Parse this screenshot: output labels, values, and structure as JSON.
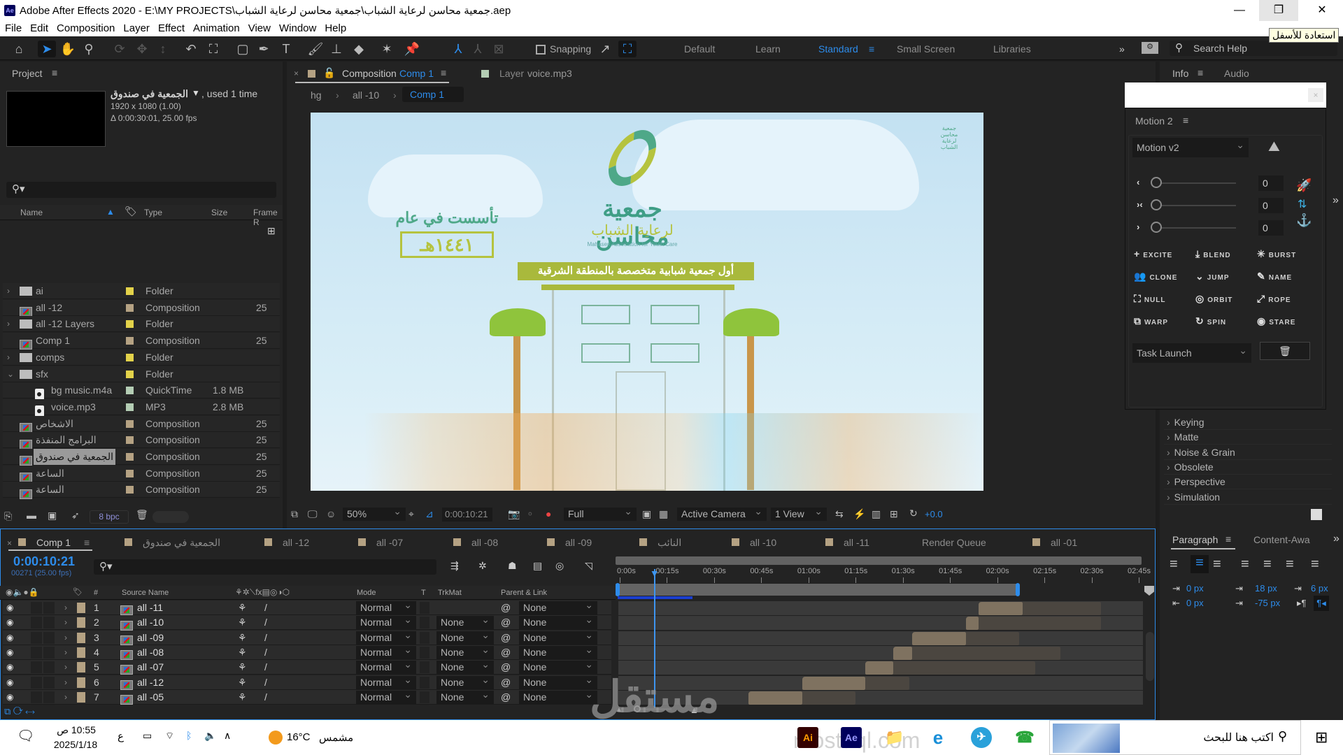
{
  "window": {
    "app_icon": "Ae",
    "title": "Adobe After Effects 2020 - E:\\MY PROJECTS\\جمعية محاسن لرعاية الشباب\\جمعية محاسن لرعاية الشباب.aep",
    "minimize": "—",
    "restore": "❐",
    "close": "✕",
    "tooltip": "استعادة للأسفل"
  },
  "menu": [
    "File",
    "Edit",
    "Composition",
    "Layer",
    "Effect",
    "Animation",
    "View",
    "Window",
    "Help"
  ],
  "toolbar": {
    "snapping_label": "Snapping",
    "workspaces": [
      "Default",
      "Learn",
      "Standard",
      "Small Screen",
      "Libraries"
    ],
    "active_workspace": "Standard",
    "search_placeholder": "Search Help"
  },
  "project": {
    "panel_title": "Project",
    "selected_name": "الجمعية في صندوق",
    "used": ", used 1 time",
    "resolution": "1920 x 1080 (1.00)",
    "duration": "Δ 0:00:30:01, 25.00 fps",
    "columns": {
      "name": "Name",
      "type": "Type",
      "size": "Size",
      "frame_rate": "Frame R"
    },
    "items": [
      {
        "name": "ai",
        "kind": "folder",
        "expand": "›",
        "color": "#e3d24a",
        "type": "Folder",
        "size": "",
        "fps": ""
      },
      {
        "name": "all -12",
        "kind": "comp",
        "expand": "",
        "color": "#b5a283",
        "type": "Composition",
        "size": "",
        "fps": "25"
      },
      {
        "name": "all -12 Layers",
        "kind": "folder",
        "expand": "›",
        "color": "#e3d24a",
        "type": "Folder",
        "size": "",
        "fps": ""
      },
      {
        "name": "Comp 1",
        "kind": "comp",
        "expand": "",
        "color": "#b5a283",
        "type": "Composition",
        "size": "",
        "fps": "25"
      },
      {
        "name": "comps",
        "kind": "folder",
        "expand": "›",
        "color": "#e3d24a",
        "type": "Folder",
        "size": "",
        "fps": ""
      },
      {
        "name": "sfx",
        "kind": "folder",
        "expand": "⌄",
        "color": "#e3d24a",
        "type": "Folder",
        "size": "",
        "fps": ""
      },
      {
        "name": "bg music.m4a",
        "kind": "audio",
        "expand": "",
        "color": "#b4cdb4",
        "type": "QuickTime",
        "size": "1.8 MB",
        "fps": ""
      },
      {
        "name": "voice.mp3",
        "kind": "audio",
        "expand": "",
        "color": "#b4cdb4",
        "type": "MP3",
        "size": "2.8 MB",
        "fps": ""
      },
      {
        "name": "الاشخاص",
        "kind": "comp",
        "expand": "",
        "color": "#b5a283",
        "type": "Composition",
        "size": "",
        "fps": "25"
      },
      {
        "name": "البرامج المنفذة",
        "kind": "comp",
        "expand": "",
        "color": "#b5a283",
        "type": "Composition",
        "size": "",
        "fps": "25"
      },
      {
        "name": "الجمعية في صندوق",
        "kind": "comp",
        "expand": "",
        "color": "#b5a283",
        "type": "Composition",
        "size": "",
        "fps": "25",
        "selected": true
      },
      {
        "name": "الساعة",
        "kind": "comp",
        "expand": "",
        "color": "#b5a283",
        "type": "Composition",
        "size": "",
        "fps": "25"
      },
      {
        "name": "الساعة",
        "kind": "comp",
        "expand": "",
        "color": "#b5a283",
        "type": "Composition",
        "size": "",
        "fps": "25"
      }
    ],
    "bpc": "8 bpc"
  },
  "composition": {
    "tab_prefix": "Composition",
    "tab_name": "Comp 1",
    "layer_tab_prefix": "Layer",
    "layer_tab_name": "voice.mp3",
    "breadcrumbs": [
      "hg",
      "all -10",
      "Comp 1"
    ],
    "content": {
      "founded": "تأسست في عام",
      "year": "١٤٤١هـ",
      "org_name": "جمعية محاسن",
      "org_sub": "لرعاية الشباب",
      "org_en": "Mahasen Association for Youth Care",
      "banner": "أول جمعية شبابية متخصصة بالمنطقة الشرقية",
      "mini_logo": "جمعية محاسن لرعاية الشباب"
    },
    "viewer_bar": {
      "zoom": "50%",
      "timecode": "0:00:10:21",
      "resolution": "Full",
      "camera": "Active Camera",
      "views": "1 View",
      "exposure": "+0.0"
    }
  },
  "right_panel": {
    "tabs": [
      "Info",
      "Audio"
    ],
    "motion_title": "Motion 2",
    "motion_preset": "Motion v2",
    "sliders": [
      {
        "icon": "‹",
        "value": "0"
      },
      {
        "icon": "›‹",
        "value": "0"
      },
      {
        "icon": "›",
        "value": "0"
      }
    ],
    "buttons": [
      {
        "icon": "+",
        "label": "EXCITE"
      },
      {
        "icon": "⤓",
        "label": "BLEND"
      },
      {
        "icon": "✳",
        "label": "BURST"
      },
      {
        "icon": "👥",
        "label": "CLONE"
      },
      {
        "icon": "⌄",
        "label": "JUMP"
      },
      {
        "icon": "✎",
        "label": "NAME"
      },
      {
        "icon": "⛶",
        "label": "NULL"
      },
      {
        "icon": "◎",
        "label": "ORBIT"
      },
      {
        "icon": "⤢",
        "label": "ROPE"
      },
      {
        "icon": "⧉",
        "label": "WARP"
      },
      {
        "icon": "↻",
        "label": "SPIN"
      },
      {
        "icon": "◉",
        "label": "STARE"
      }
    ],
    "task": "Task Launch",
    "effects": [
      "Keying",
      "Matte",
      "Noise & Grain",
      "Obsolete",
      "Perspective",
      "Simulation"
    ]
  },
  "timeline": {
    "tabs": [
      {
        "label": "Comp 1",
        "active": true
      },
      {
        "label": "الجمعية في صندوق"
      },
      {
        "label": "all -12"
      },
      {
        "label": "all -07"
      },
      {
        "label": "all -08"
      },
      {
        "label": "all -09"
      },
      {
        "label": "النائب"
      },
      {
        "label": "all -10"
      },
      {
        "label": "all -11"
      },
      {
        "label": "Render Queue",
        "noswatch": true
      },
      {
        "label": "all -01"
      }
    ],
    "timecode": "0:00:10:21",
    "frame": "00271 (25.00 fps)",
    "columns": {
      "hash": "#",
      "source": "Source Name",
      "mode": "Mode",
      "t": "T",
      "trkmat": "TrkMat",
      "parent": "Parent & Link"
    },
    "ruler": [
      "0:00s",
      "00:15s",
      "00:30s",
      "00:45s",
      "01:00s",
      "01:15s",
      "01:30s",
      "01:45s",
      "02:00s",
      "02:15s",
      "02:30s",
      "02:45s"
    ],
    "current_time_sec": 10.84,
    "layers": [
      {
        "num": "1",
        "name": "all -11",
        "mode": "Normal",
        "trkmat": "",
        "parent": "None",
        "start": 114,
        "in_end": 128,
        "end": 153
      },
      {
        "num": "2",
        "name": "all -10",
        "mode": "Normal",
        "trkmat": "None",
        "parent": "None",
        "start": 110,
        "in_end": 114,
        "end": 153
      },
      {
        "num": "3",
        "name": "all -09",
        "mode": "Normal",
        "trkmat": "None",
        "parent": "None",
        "start": 93,
        "in_end": 110,
        "end": 127
      },
      {
        "num": "4",
        "name": "all -08",
        "mode": "Normal",
        "trkmat": "None",
        "parent": "None",
        "start": 87,
        "in_end": 93,
        "end": 140
      },
      {
        "num": "5",
        "name": "all -07",
        "mode": "Normal",
        "trkmat": "None",
        "parent": "None",
        "start": 78,
        "in_end": 87,
        "end": 132
      },
      {
        "num": "6",
        "name": "all -12",
        "mode": "Normal",
        "trkmat": "None",
        "parent": "None",
        "start": 58,
        "in_end": 78,
        "end": 92
      },
      {
        "num": "7",
        "name": "all -05",
        "mode": "Normal",
        "trkmat": "None",
        "parent": "None",
        "start": 41,
        "in_end": 58,
        "end": 75
      }
    ]
  },
  "paragraph": {
    "tabs": [
      "Paragraph",
      "Content-Awa"
    ],
    "indent_left": "0 px",
    "indent_right": "0 px",
    "space_before": "18 px",
    "space_after": "-75 px",
    "first_line": "6 px"
  },
  "taskbar": {
    "time": "10:55 ص",
    "date": "2025/1/18",
    "lang": "ع",
    "weather_temp": "16°C",
    "weather_label": "مشمس",
    "search": "اكتب هنا للبحث",
    "apps": [
      "Ai",
      "Ae",
      "📁",
      "e",
      "✈",
      "☎"
    ],
    "watermark": "mostaql.com",
    "watermark_ar": "مستقل"
  }
}
